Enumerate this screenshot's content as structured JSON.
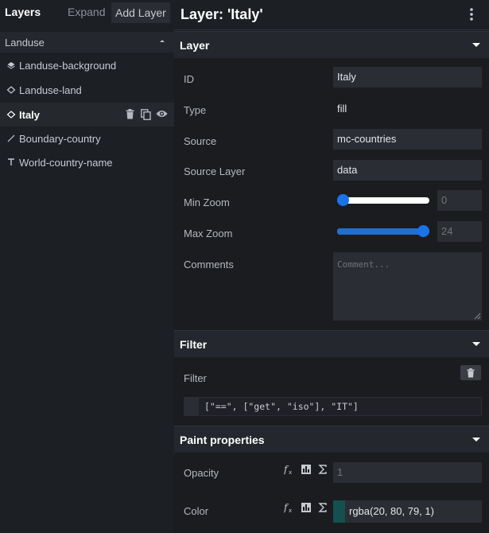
{
  "layers_panel": {
    "title": "Layers",
    "expand_label": "Expand",
    "add_label": "Add Layer",
    "group": {
      "label": "Landuse"
    },
    "items": [
      {
        "label": "Landuse-background",
        "icon": "background-layer-icon"
      },
      {
        "label": "Landuse-land",
        "icon": "fill-layer-icon"
      },
      {
        "label": "Italy",
        "icon": "fill-layer-icon",
        "selected": true
      },
      {
        "label": "Boundary-country",
        "icon": "line-layer-icon"
      },
      {
        "label": "World-country-name",
        "icon": "symbol-layer-icon"
      }
    ]
  },
  "editor": {
    "title": "Layer: 'Italy'",
    "layer_section": {
      "title": "Layer",
      "id_label": "ID",
      "id_value": "Italy",
      "type_label": "Type",
      "type_value": "fill",
      "source_label": "Source",
      "source_value": "mc-countries",
      "source_layer_label": "Source Layer",
      "source_layer_value": "data",
      "min_zoom_label": "Min Zoom",
      "min_zoom_placeholder": "0",
      "min_zoom_value": 0,
      "max_zoom_label": "Max Zoom",
      "max_zoom_placeholder": "24",
      "max_zoom_value": 24,
      "zoom_range": [
        0,
        24
      ],
      "comments_label": "Comments",
      "comments_placeholder": "Comment..."
    },
    "filter_section": {
      "title": "Filter",
      "filter_label": "Filter",
      "expression": "[\"==\", [\"get\", \"iso\"], \"IT\"]"
    },
    "paint_section": {
      "title": "Paint properties",
      "opacity_label": "Opacity",
      "opacity_placeholder": "1",
      "color_label": "Color",
      "color_value": "rgba(20, 80, 79, 1)"
    }
  },
  "colors": {
    "accent": "#1a73e8",
    "swatch": "#14504f"
  }
}
